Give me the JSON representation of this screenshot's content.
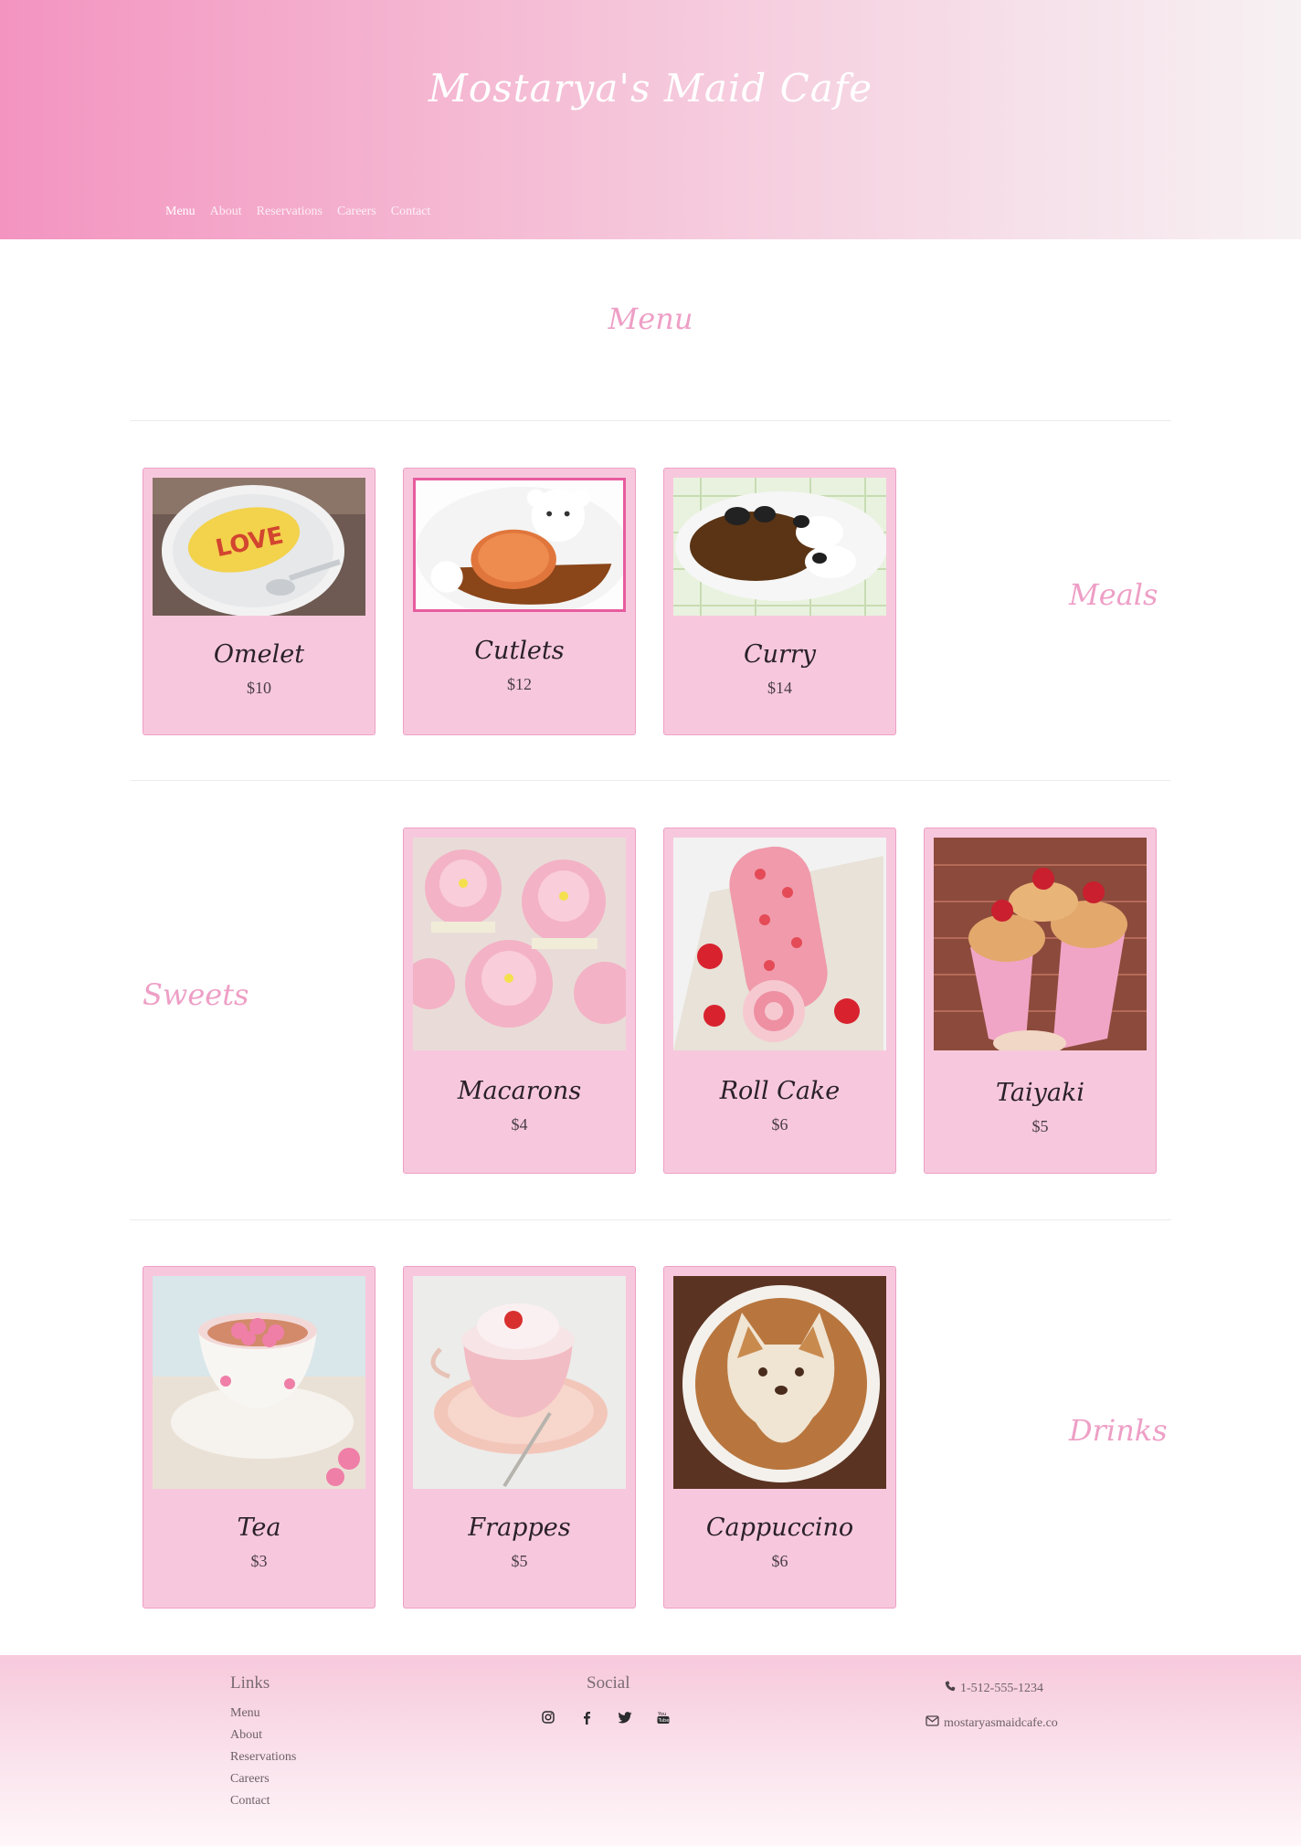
{
  "site": {
    "title": "Mostarya's Maid Cafe"
  },
  "nav": {
    "items": [
      "Menu",
      "About",
      "Reservations",
      "Careers",
      "Contact"
    ],
    "active": "Menu"
  },
  "page": {
    "title": "Menu"
  },
  "sections": [
    {
      "label": "Meals",
      "items": [
        {
          "name": "Omelet",
          "price": "$10"
        },
        {
          "name": "Cutlets",
          "price": "$12"
        },
        {
          "name": "Curry",
          "price": "$14"
        }
      ]
    },
    {
      "label": "Sweets",
      "items": [
        {
          "name": "Macarons",
          "price": "$4"
        },
        {
          "name": "Roll Cake",
          "price": "$6"
        },
        {
          "name": "Taiyaki",
          "price": "$5"
        }
      ]
    },
    {
      "label": "Drinks",
      "items": [
        {
          "name": "Tea",
          "price": "$3"
        },
        {
          "name": "Frappes",
          "price": "$5"
        },
        {
          "name": "Cappuccino",
          "price": "$6"
        }
      ]
    }
  ],
  "footer": {
    "links_heading": "Links",
    "links": [
      "Menu",
      "About",
      "Reservations",
      "Careers",
      "Contact"
    ],
    "social_heading": "Social",
    "social_icons": [
      "instagram-icon",
      "facebook-icon",
      "twitter-icon",
      "youtube-icon"
    ],
    "phone": "1-512-555-1234",
    "email": "mostaryasmaidcafe.co"
  },
  "colors": {
    "accent": "#ee9fc6",
    "card_bg": "#f7c8dd",
    "highlight_border": "#e75c9e",
    "header_start": "#f394c0",
    "header_end": "#f7f1f3"
  }
}
